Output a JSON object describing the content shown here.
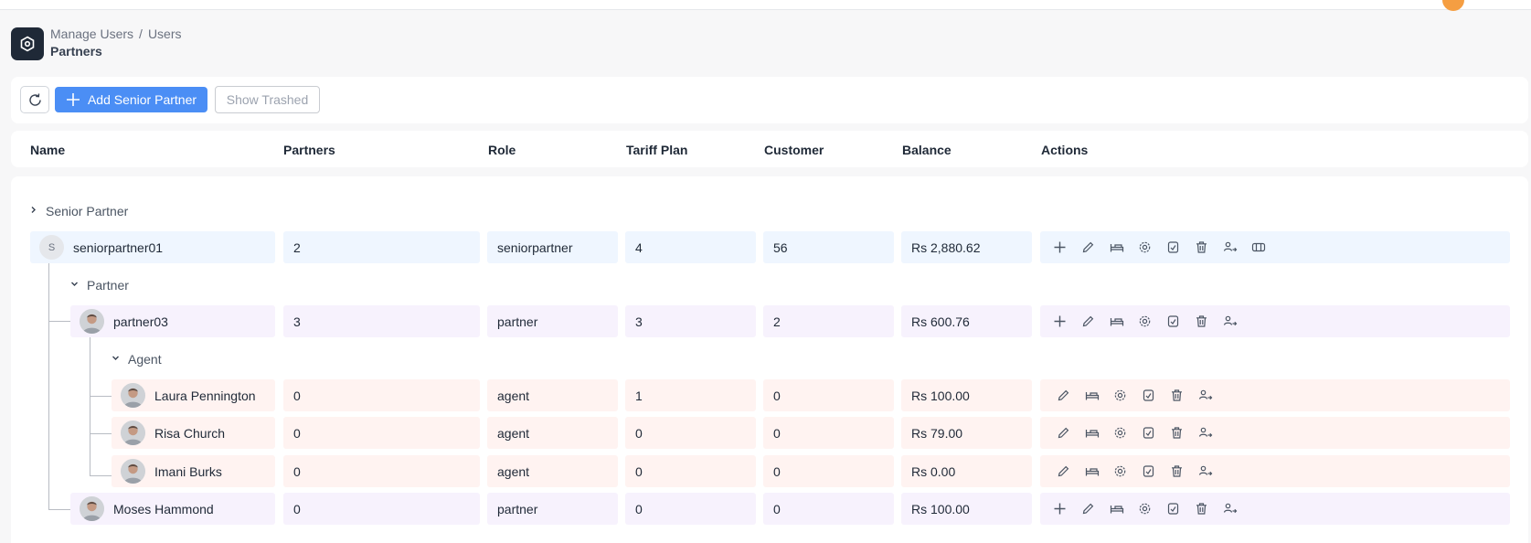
{
  "breadcrumb": {
    "parent": "Manage Users",
    "current": "Users"
  },
  "page_title": "Partners",
  "toolbar": {
    "add_label": "Add Senior Partner",
    "trash_label": "Show Trashed"
  },
  "columns": {
    "name": "Name",
    "partners": "Partners",
    "role": "Role",
    "tariff": "Tariff Plan",
    "customer": "Customer",
    "balance": "Balance",
    "actions": "Actions"
  },
  "groups": {
    "senior": "Senior Partner",
    "partner": "Partner",
    "agent": "Agent"
  },
  "rows": {
    "senior": {
      "avatar_letter": "S",
      "name": "seniorpartner01",
      "partners": "2",
      "role": "seniorpartner",
      "tariff": "4",
      "customer": "56",
      "balance": "Rs 2,880.62"
    },
    "partner03": {
      "name": "partner03",
      "partners": "3",
      "role": "partner",
      "tariff": "3",
      "customer": "2",
      "balance": "Rs 600.76"
    },
    "laura": {
      "name": "Laura Pennington",
      "partners": "0",
      "role": "agent",
      "tariff": "1",
      "customer": "0",
      "balance": "Rs 100.00"
    },
    "risa": {
      "name": "Risa Church",
      "partners": "0",
      "role": "agent",
      "tariff": "0",
      "customer": "0",
      "balance": "Rs 79.00"
    },
    "imani": {
      "name": "Imani Burks",
      "partners": "0",
      "role": "agent",
      "tariff": "0",
      "customer": "0",
      "balance": "Rs 0.00"
    },
    "moses": {
      "name": "Moses Hammond",
      "partners": "0",
      "role": "partner",
      "tariff": "0",
      "customer": "0",
      "balance": "Rs 100.00"
    }
  },
  "colors": {
    "accent": "#4b8ef5",
    "senior_row_bg": "#eff6ff",
    "partner_row_bg": "#f7f2fd",
    "agent_row_bg": "#fff3f1"
  }
}
